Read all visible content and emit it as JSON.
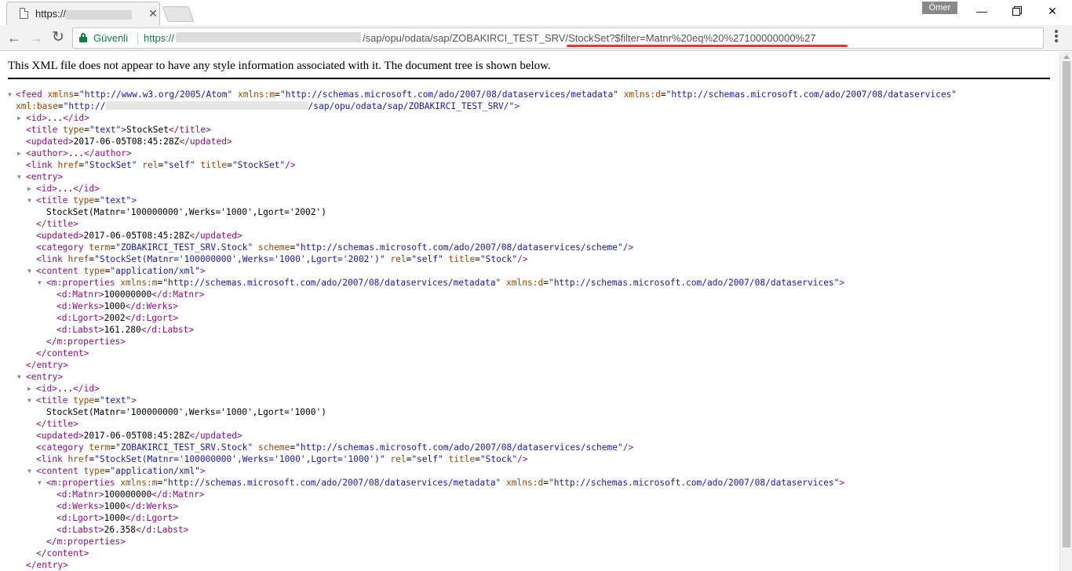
{
  "browser": {
    "tab_title": "https://",
    "user_name": "Ömer",
    "secure_label": "Güvenli",
    "url_scheme": "https://",
    "url_path_prefix": "/sap/opu/odata/sap/ZOBAKIRCI_TEST_SRV/",
    "url_path_highlight": "StockSet?$filter=Matnr%20eq%20%27100000000%27"
  },
  "page": {
    "xml_info": "This XML file does not appear to have any style information associated with it. The document tree is shown below."
  },
  "xml": {
    "feed_xmlns": "\"http://www.w3.org/2005/Atom\"",
    "feed_xmlns_m": "\"http://schemas.microsoft.com/ado/2007/08/dataservices/metadata\"",
    "feed_xmlns_d": "\"http://schemas.microsoft.com/ado/2007/08/dataservices\"",
    "feed_base_prefix": "\"http://",
    "feed_base_suffix": "/sap/opu/odata/sap/ZOBAKIRCI_TEST_SRV/\"",
    "collapsed_ellipsis": "...",
    "feed_title_type": "\"text\"",
    "feed_title": "StockSet",
    "feed_updated": "2017-06-05T08:45:28Z",
    "feed_link_href": "\"StockSet\"",
    "feed_link_rel": "\"self\"",
    "feed_link_title": "\"StockSet\"",
    "category_term": "\"ZOBAKIRCI_TEST_SRV.Stock\"",
    "category_scheme": "\"http://schemas.microsoft.com/ado/2007/08/dataservices/scheme\"",
    "content_type": "\"application/xml\"",
    "props_xmlns_m": "\"http://schemas.microsoft.com/ado/2007/08/dataservices/metadata\"",
    "props_xmlns_d": "\"http://schemas.microsoft.com/ado/2007/08/dataservices\"",
    "entry_link_rel": "\"self\"",
    "entry_link_title": "\"Stock\"",
    "entries": [
      {
        "title_text": "StockSet(Matnr='100000000',Werks='1000',Lgort='2002')",
        "updated": "2017-06-05T08:45:28Z",
        "link_href": "\"StockSet(Matnr='100000000',Werks='1000',Lgort='2002')\"",
        "matnr": "100000000",
        "werks": "1000",
        "lgort": "2002",
        "labst": "161.280"
      },
      {
        "title_text": "StockSet(Matnr='100000000',Werks='1000',Lgort='1000')",
        "updated": "2017-06-05T08:45:28Z",
        "link_href": "\"StockSet(Matnr='100000000',Werks='1000',Lgort='1000')\"",
        "matnr": "100000000",
        "werks": "1000",
        "lgort": "1000",
        "labst": "26.358"
      }
    ]
  }
}
